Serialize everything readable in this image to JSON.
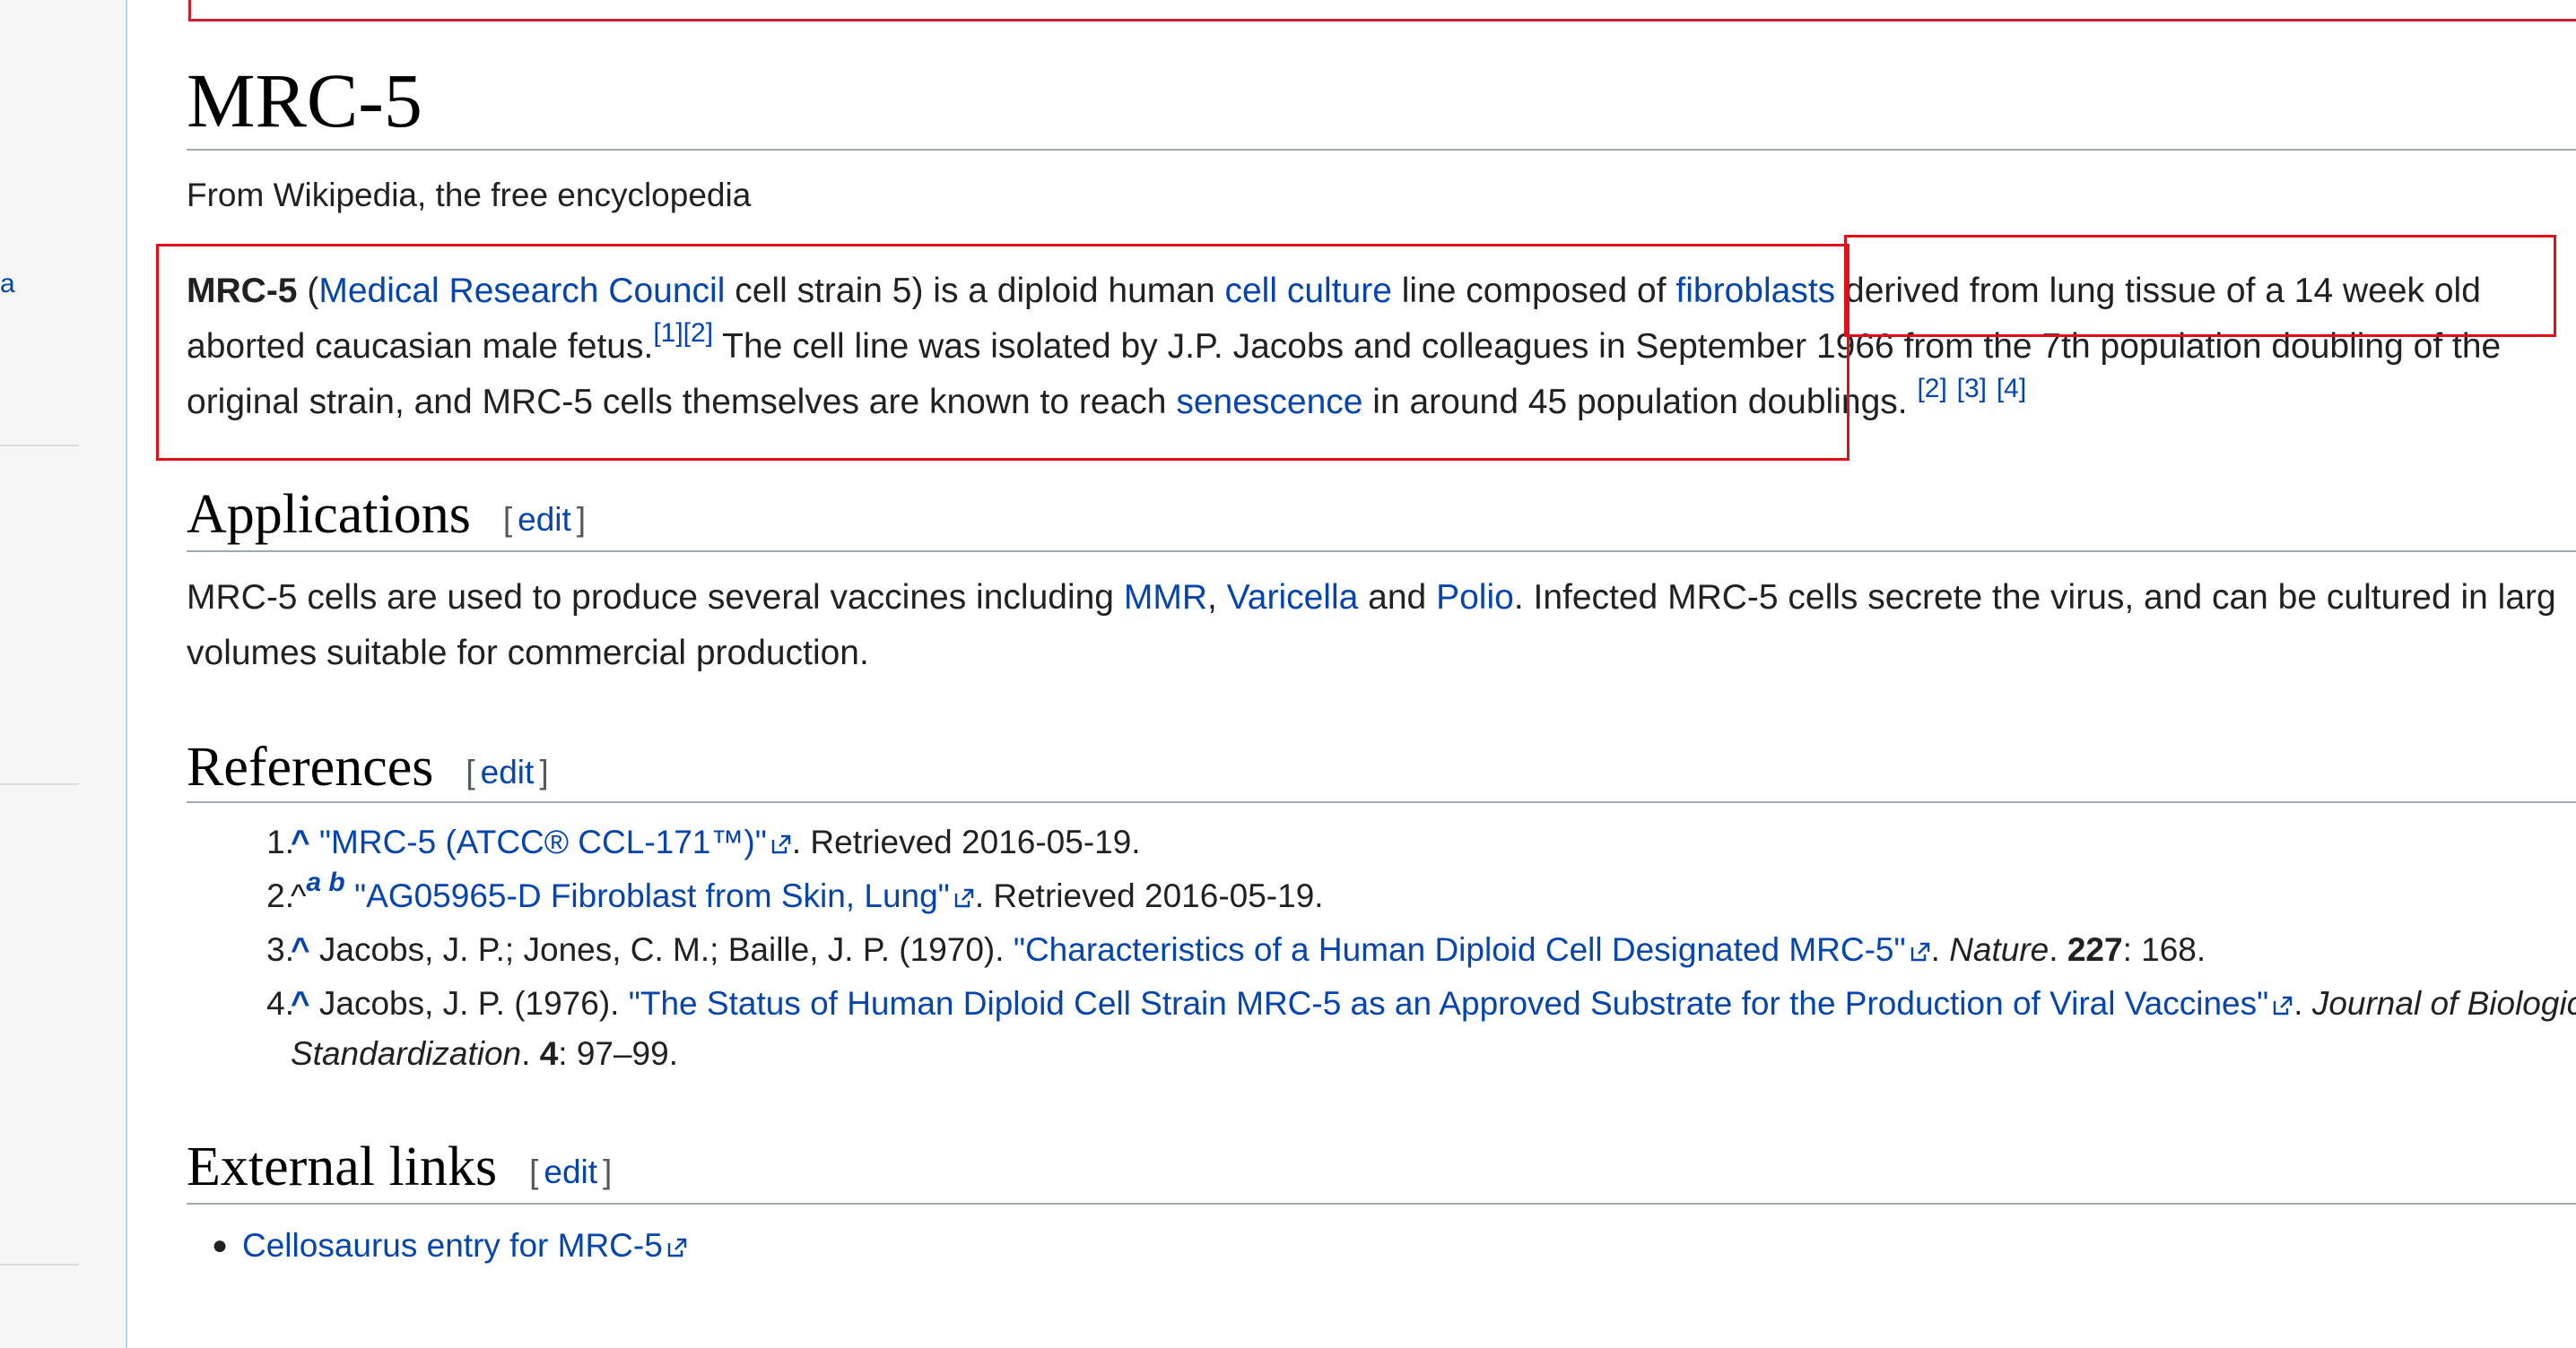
{
  "sidebar": {
    "partial_link": "a"
  },
  "article": {
    "title": "MRC-5",
    "tagline": "From Wikipedia, the free encyclopedia",
    "intro": {
      "bold": "MRC-5",
      "open_paren": " (",
      "link_mrc": "Medical Research Council",
      "t1": " cell strain 5) is a diploid human ",
      "link_cell_culture": "cell culture",
      "t2": " line composed of ",
      "link_fibroblasts": "fibroblasts",
      "t3": " derived from lung tissue of a 14 week old",
      "t4": "aborted caucasian male fetus.",
      "cite_1": "[1]",
      "cite_2": "[2]",
      "t5": " The cell line was isolated by J.P. Jacobs and colleagues in September 1966 from the 7th population doubling of the",
      "t6": "original strain, and MRC-5 cells themselves are known to reach ",
      "link_senescence": "senescence",
      "t7": " in around 45 population doublings. ",
      "cite_2b": "[2]",
      "cite_3": "[3]",
      "cite_4": "[4]"
    },
    "edit_label": "edit",
    "edit_open": "[",
    "edit_close": "]",
    "applications": {
      "heading": "Applications",
      "t1": "MRC-5 cells are used to produce several vaccines including ",
      "link_mmr": "MMR",
      "comma": ", ",
      "link_varicella": "Varicella",
      "and": " and ",
      "link_polio": "Polio",
      "t2": ". Infected MRC-5 cells secrete the virus, and can be cultured in larg",
      "t3": "volumes suitable for commercial production."
    },
    "references": {
      "heading": "References",
      "items": [
        {
          "num": "1.",
          "caret": "^",
          "link": "\"MRC-5 (ATCC® CCL-171™)\"",
          "after": ". Retrieved 2016-05-19."
        },
        {
          "num": "2.",
          "caret": "^",
          "backlinks": "a b",
          "link": "\"AG05965-D Fibroblast from Skin, Lung\"",
          "after": ". Retrieved 2016-05-19."
        },
        {
          "num": "3.",
          "caret": "^",
          "before": " Jacobs, J. P.; Jones, C. M.; Baille, J. P. (1970). ",
          "link": "\"Characteristics of a Human Diploid Cell Designated MRC-5\"",
          "after_pre": ". ",
          "journal": "Nature",
          "after_mid": ". ",
          "volume": "227",
          "after": ": 168."
        },
        {
          "num": "4.",
          "caret": "^",
          "before": " Jacobs, J. P. (1976). ",
          "link": "\"The Status of Human Diploid Cell Strain MRC-5 as an Approved Substrate for the Production of Viral Vaccines\"",
          "after_pre": ". ",
          "journal": "Journal of Biologica",
          "journal2": "Standardization",
          "after_mid": ". ",
          "volume": "4",
          "after": ": 97–99."
        }
      ]
    },
    "external_links": {
      "heading": "External links",
      "items": [
        {
          "link": "Cellosaurus entry for MRC-5"
        }
      ]
    }
  },
  "colors": {
    "link": "#0645ad",
    "highlight": "#e0101a",
    "sidebar_border": "#a7d7f9"
  }
}
